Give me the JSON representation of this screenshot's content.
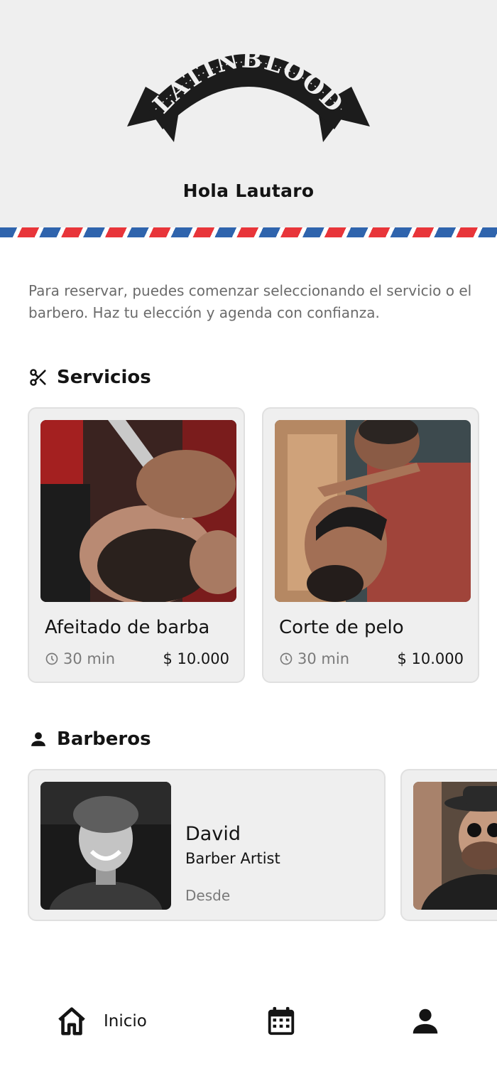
{
  "header": {
    "logo_text": "LATINBLOOD",
    "greeting": "Hola Lautaro"
  },
  "intro": {
    "text": "Para reservar, puedes comenzar seleccionando el servicio o el barbero. Haz tu elección y agenda con confianza."
  },
  "services": {
    "title": "Servicios",
    "icon": "scissors-icon",
    "items": [
      {
        "name": "Afeitado de barba",
        "duration": "30 min",
        "price": "$ 10.000"
      },
      {
        "name": "Corte de pelo",
        "duration": "30 min",
        "price": "$ 10.000"
      }
    ]
  },
  "barbers": {
    "title": "Barberos",
    "icon": "person-icon",
    "items": [
      {
        "name": "David",
        "role": "Barber Artist",
        "from_label": "Desde"
      }
    ]
  },
  "nav": {
    "home_label": "Inicio",
    "home_icon": "home-icon",
    "calendar_icon": "calendar-icon",
    "profile_icon": "profile-icon"
  },
  "colors": {
    "header_bg": "#efefef",
    "stripe_blue": "#2f64ad",
    "stripe_red": "#e8353a",
    "card_bg": "#efefef",
    "text_dark": "#141414",
    "text_muted": "#6b6b6b"
  }
}
